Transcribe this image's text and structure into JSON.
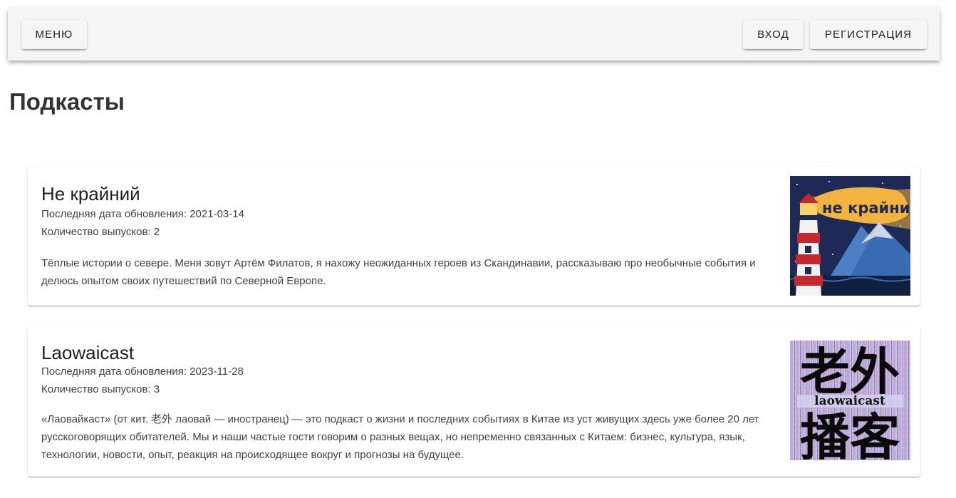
{
  "appbar": {
    "menu_label": "Меню",
    "login_label": "Вход",
    "register_label": "Регистрация"
  },
  "page": {
    "title": "Подкасты"
  },
  "podcasts": [
    {
      "title": "Не крайний",
      "last_update": "Последняя дата обновления: 2021-03-14",
      "episodes": "Количество выпусков: 2",
      "description": "Тёплые истории о севере. Меня зовут Артём Филатов, я нахожу неожиданных героев из Скандинавии, рассказываю про необычные события и делюсь опытом своих путешествий по Северной Европе.",
      "cover_text": "не крайний"
    },
    {
      "title": "Laowaicast",
      "last_update": "Последняя дата обновления: 2023-11-28",
      "episodes": "Количество выпусков: 3",
      "description": "«Лаовайкаст» (от кит. 老外 лаовай — иностранец) — это подкаст о жизни и последних событиях в Китае из уст живущих здесь уже более 20 лет русскоговорящих обитателей. Мы и наши частые гости говорим о разных вещах, но непременно связанных с Китаем: бизнес, культура, язык, технологии, новости, опыт, реакция на происходящее вокруг и прогнозы на будущее.",
      "cover_text_top": "老外",
      "cover_text_mid": "laowaicast",
      "cover_text_bottom": "播客"
    }
  ]
}
